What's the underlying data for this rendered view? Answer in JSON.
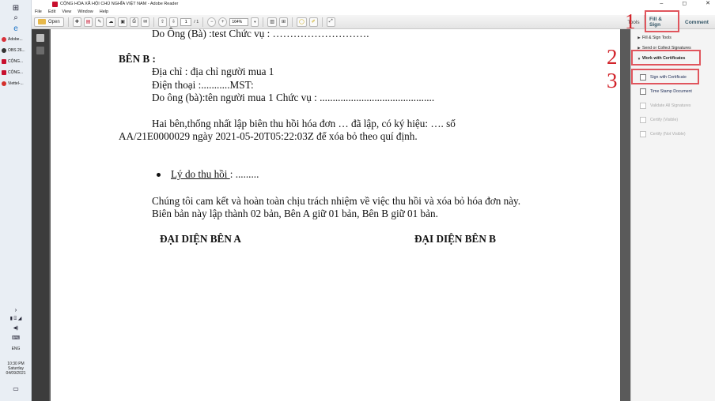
{
  "window": {
    "title": "CỘNG HÒA XÃ HỘI CHỦ NGHĨA VIỆT NAM - Adobe Reader",
    "controls": [
      "–",
      "◻",
      "✕"
    ]
  },
  "menubar": [
    "File",
    "Edit",
    "View",
    "Window",
    "Help"
  ],
  "toolbar": {
    "open_label": "Open",
    "page_current": "1",
    "page_total": "/ 1",
    "zoom": "164%"
  },
  "right_tabs": {
    "tools": "Tools",
    "fill_sign": "Fill & Sign",
    "comment": "Comment"
  },
  "taskbar": {
    "apps": [
      {
        "label": "Adobe...",
        "color": "#d9313a"
      },
      {
        "label": "OBS 26...",
        "color": "#333333"
      },
      {
        "label": "CỘNG...",
        "color": "#c8102e"
      },
      {
        "label": "CỘNG...",
        "color": "#c8102e"
      },
      {
        "label": "Viettel-...",
        "color": "#d4302b"
      }
    ],
    "lang": "ENG",
    "time": "10:30 PM",
    "day": "Saturday",
    "date": "04/09/2021"
  },
  "document": {
    "line_signer_a": "Do Ông (Bà) :test       Chức vụ : ……………………….",
    "ben_b": "BÊN B :",
    "address": "Địa chỉ :  địa chỉ người mua 1",
    "phone": "Điện thoại :...........MST:",
    "signer_b": "Do ông (bà):tên người mua 1   Chức vụ : ............................................",
    "agree_1": "Hai bên,thống nhất lập biên thu hồi hóa đơn … đã lập, có ký hiệu: …. số",
    "agree_2": "AA/21E0000029 ngày 2021-05-20T05:22:03Z để xóa bỏ theo quí định.",
    "reason_label": "Lý do thu hồi ",
    "reason_value": " : .........",
    "commit_1": "Chúng tôi cam kết và hoàn toàn chịu trách nhiệm về việc thu hồi và xóa bỏ hóa đơn này.",
    "commit_2": "Biên bản này lập thành 02 bản, Bên A giữ 01 bản, Bên B giữ 01 bản.",
    "rep_a": "ĐẠI DIỆN BÊN A",
    "rep_b": "ĐẠI DIỆN BÊN B"
  },
  "pane": {
    "fill_sign_tools": "Fill & Sign Tools",
    "send_collect": "Send or Collect Signatures",
    "work_with_certs": "Work with Certificates",
    "items": [
      {
        "label": "Sign with Certificate",
        "enabled": true
      },
      {
        "label": "Time Stamp Document",
        "enabled": true
      },
      {
        "label": "Validate All Signatures",
        "enabled": false
      },
      {
        "label": "Certify (Visible)",
        "enabled": false
      },
      {
        "label": "Certify (Not Visible)",
        "enabled": false
      }
    ]
  },
  "annotations": [
    "1",
    "2",
    "3"
  ],
  "colors": {
    "annotation": "#e0555d",
    "annotation_number": "#d2232a",
    "doc_bg": "#5a5a5a"
  }
}
